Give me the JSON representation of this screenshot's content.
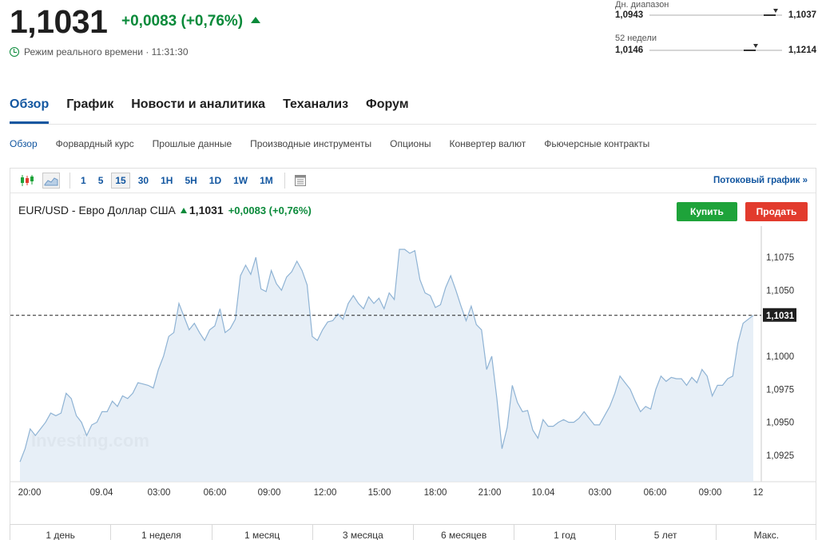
{
  "quote": {
    "price": "1,1031",
    "change": "+0,0083 (+0,76%)",
    "realtime_label": "Режим реального времени · 11:31:30"
  },
  "day_range": {
    "label": "Дн. диапазон",
    "low": "1,0943",
    "high": "1,1037",
    "position": 0.95
  },
  "week52_range": {
    "label": "52 недели",
    "low": "1,0146",
    "high": "1,1214",
    "position": 0.8
  },
  "main_tabs": [
    {
      "label": "Обзор",
      "active": true
    },
    {
      "label": "График"
    },
    {
      "label": "Новости и аналитика"
    },
    {
      "label": "Теханализ"
    },
    {
      "label": "Форум"
    }
  ],
  "sub_tabs": [
    {
      "label": "Обзор",
      "active": true
    },
    {
      "label": "Форвардный курс"
    },
    {
      "label": "Прошлые данные"
    },
    {
      "label": "Производные инструменты"
    },
    {
      "label": "Опционы"
    },
    {
      "label": "Конвертер валют"
    },
    {
      "label": "Фьючерсные контракты"
    }
  ],
  "toolbar": {
    "icons": [
      "candlestick-icon",
      "area-chart-icon",
      "calendar-icon"
    ],
    "intervals": [
      "1",
      "5",
      "15",
      "30",
      "1H",
      "5H",
      "1D",
      "1W",
      "1M"
    ],
    "selected_interval": "15",
    "stream_link": "Потоковый график »"
  },
  "instrument": {
    "name": "EUR/USD - Евро Доллар США",
    "last": "1,1031",
    "change": "+0,0083 (+0,76%)",
    "buy_label": "Купить",
    "sell_label": "Продать"
  },
  "watermark": "Investing.com",
  "periods": [
    "1 день",
    "1 неделя",
    "1 месяц",
    "3 месяца",
    "6 месяцев",
    "1 год",
    "5 лет",
    "Макс."
  ],
  "colors": {
    "accent": "#1256a0",
    "up": "#0a8a3a",
    "buy": "#1ea33a",
    "sell": "#e23b2d",
    "area_fill": "#e3ecf6",
    "line": "#8fb3d4"
  },
  "chart_data": {
    "type": "area",
    "x_ticks": [
      "20:00",
      "09.04",
      "03:00",
      "06:00",
      "09:00",
      "12:00",
      "15:00",
      "18:00",
      "21:00",
      "10.04",
      "03:00",
      "06:00",
      "09:00",
      "12"
    ],
    "y_ticks": [
      "1,1075",
      "1,1050",
      "1,1000",
      "1,0975",
      "1,0950",
      "1,0925"
    ],
    "ylim": [
      1.0905,
      1.1095
    ],
    "last_value": 1.1031,
    "last_label": "1,1031",
    "values": [
      1.092,
      1.093,
      1.0945,
      1.094,
      1.0945,
      1.095,
      1.0957,
      1.0955,
      1.0957,
      1.0972,
      1.0968,
      1.0955,
      1.095,
      1.094,
      1.0948,
      1.095,
      1.0958,
      1.0958,
      1.0966,
      1.0962,
      1.097,
      1.0968,
      1.0972,
      1.098,
      1.0979,
      1.0978,
      1.0976,
      1.099,
      1.1,
      1.1015,
      1.1018,
      1.104,
      1.103,
      1.102,
      1.1025,
      1.1018,
      1.1012,
      1.102,
      1.1023,
      1.1036,
      1.1018,
      1.1021,
      1.1028,
      1.1061,
      1.1069,
      1.1062,
      1.1075,
      1.1051,
      1.1049,
      1.1065,
      1.1055,
      1.105,
      1.106,
      1.1064,
      1.1072,
      1.1065,
      1.1054,
      1.1015,
      1.1012,
      1.102,
      1.1026,
      1.1027,
      1.1032,
      1.1028,
      1.104,
      1.1046,
      1.104,
      1.1036,
      1.1045,
      1.104,
      1.1044,
      1.1036,
      1.1048,
      1.1043,
      1.1081,
      1.1081,
      1.1078,
      1.108,
      1.1058,
      1.1048,
      1.1046,
      1.1037,
      1.1039,
      1.1052,
      1.1061,
      1.105,
      1.1038,
      1.1027,
      1.1038,
      1.1024,
      1.102,
      1.099,
      1.1,
      1.0968,
      1.093,
      1.0946,
      1.0978,
      1.0965,
      1.0958,
      1.0959,
      1.0944,
      1.0938,
      1.0952,
      1.0947,
      1.0947,
      1.095,
      1.0952,
      1.095,
      1.095,
      1.0953,
      1.0958,
      1.0953,
      1.0948,
      1.0948,
      1.0955,
      1.0962,
      1.0972,
      1.0985,
      1.098,
      1.0975,
      1.0966,
      1.0958,
      1.0962,
      1.096,
      1.0975,
      1.0985,
      1.0981,
      1.0984,
      1.0983,
      1.0983,
      1.0978,
      1.0984,
      1.098,
      1.099,
      1.0985,
      1.097,
      1.0978,
      1.0978,
      1.0983,
      1.0985,
      1.101,
      1.1025,
      1.1028,
      1.1031
    ]
  }
}
